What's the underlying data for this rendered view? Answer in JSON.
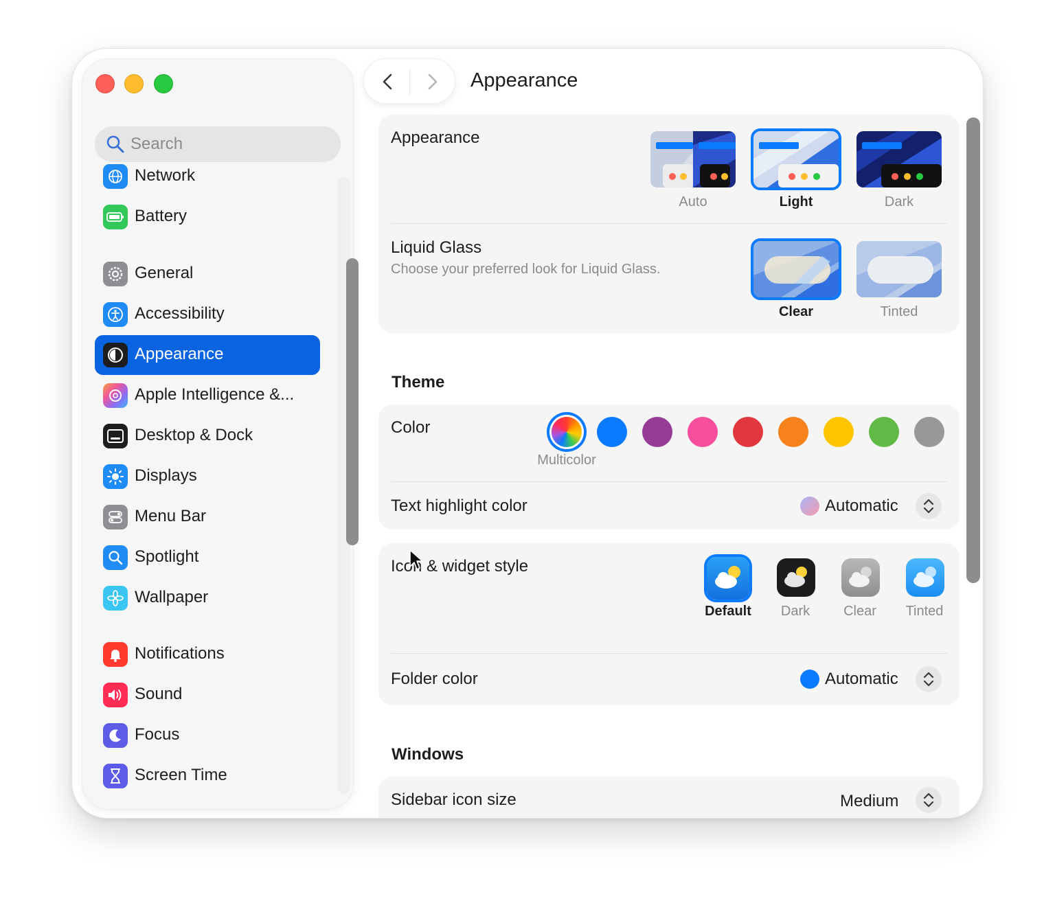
{
  "window": {
    "title": "Appearance",
    "nav": {
      "back": "chevron-left-icon",
      "forward": "chevron-right-icon"
    }
  },
  "sidebar": {
    "search_placeholder": "Search",
    "items": [
      {
        "label": "Network",
        "icon": "globe-icon",
        "color": "#1f8bf5"
      },
      {
        "label": "Battery",
        "icon": "battery-icon",
        "color": "#34c759"
      },
      {
        "label": "General",
        "icon": "gear-icon",
        "color": "#8e8e93"
      },
      {
        "label": "Accessibility",
        "icon": "accessibility-icon",
        "color": "#1f8bf5"
      },
      {
        "label": "Appearance",
        "icon": "appearance-icon",
        "color": "#1d1d1f",
        "active": true
      },
      {
        "label": "Apple Intelligence &...",
        "icon": "apple-intelligence-icon",
        "color": "#f2a23a"
      },
      {
        "label": "Desktop & Dock",
        "icon": "dock-icon",
        "color": "#1d1d1f"
      },
      {
        "label": "Displays",
        "icon": "sun-icon",
        "color": "#1f8bf5"
      },
      {
        "label": "Menu Bar",
        "icon": "menubar-icon",
        "color": "#8e8e93"
      },
      {
        "label": "Spotlight",
        "icon": "magnifier-icon",
        "color": "#1f8bf5"
      },
      {
        "label": "Wallpaper",
        "icon": "flower-icon",
        "color": "#3ac6f0"
      },
      {
        "label": "Notifications",
        "icon": "bell-icon",
        "color": "#ff3b30"
      },
      {
        "label": "Sound",
        "icon": "speaker-icon",
        "color": "#ff2d55"
      },
      {
        "label": "Focus",
        "icon": "moon-icon",
        "color": "#5e5ce6"
      },
      {
        "label": "Screen Time",
        "icon": "hourglass-icon",
        "color": "#5e5ce6"
      }
    ]
  },
  "appearance": {
    "label": "Appearance",
    "options": [
      {
        "label": "Auto",
        "selected": false
      },
      {
        "label": "Light",
        "selected": true
      },
      {
        "label": "Dark",
        "selected": false
      }
    ]
  },
  "liquid_glass": {
    "label": "Liquid Glass",
    "description": "Choose your preferred look for Liquid Glass.",
    "options": [
      {
        "label": "Clear",
        "selected": true
      },
      {
        "label": "Tinted",
        "selected": false
      }
    ]
  },
  "theme": {
    "section_title": "Theme",
    "color_label": "Color",
    "selected_color_label": "Multicolor",
    "colors": [
      {
        "name": "multicolor",
        "hex": "#multicolor"
      },
      {
        "name": "blue",
        "hex": "#0a7aff"
      },
      {
        "name": "purple",
        "hex": "#953d96"
      },
      {
        "name": "pink",
        "hex": "#f74f9e"
      },
      {
        "name": "red",
        "hex": "#e0383e"
      },
      {
        "name": "orange",
        "hex": "#f7821b"
      },
      {
        "name": "yellow",
        "hex": "#ffc600"
      },
      {
        "name": "green",
        "hex": "#62ba46"
      },
      {
        "name": "graphite",
        "hex": "#989898"
      }
    ],
    "text_highlight": {
      "label": "Text highlight color",
      "value": "Automatic"
    }
  },
  "icon_widget": {
    "label": "Icon & widget style",
    "options": [
      {
        "label": "Default",
        "selected": true
      },
      {
        "label": "Dark",
        "selected": false
      },
      {
        "label": "Clear",
        "selected": false
      },
      {
        "label": "Tinted",
        "selected": false
      }
    ],
    "folder_color": {
      "label": "Folder color",
      "value": "Automatic"
    }
  },
  "windows": {
    "section_title": "Windows",
    "sidebar_icon_size": {
      "label": "Sidebar icon size",
      "value": "Medium"
    }
  }
}
